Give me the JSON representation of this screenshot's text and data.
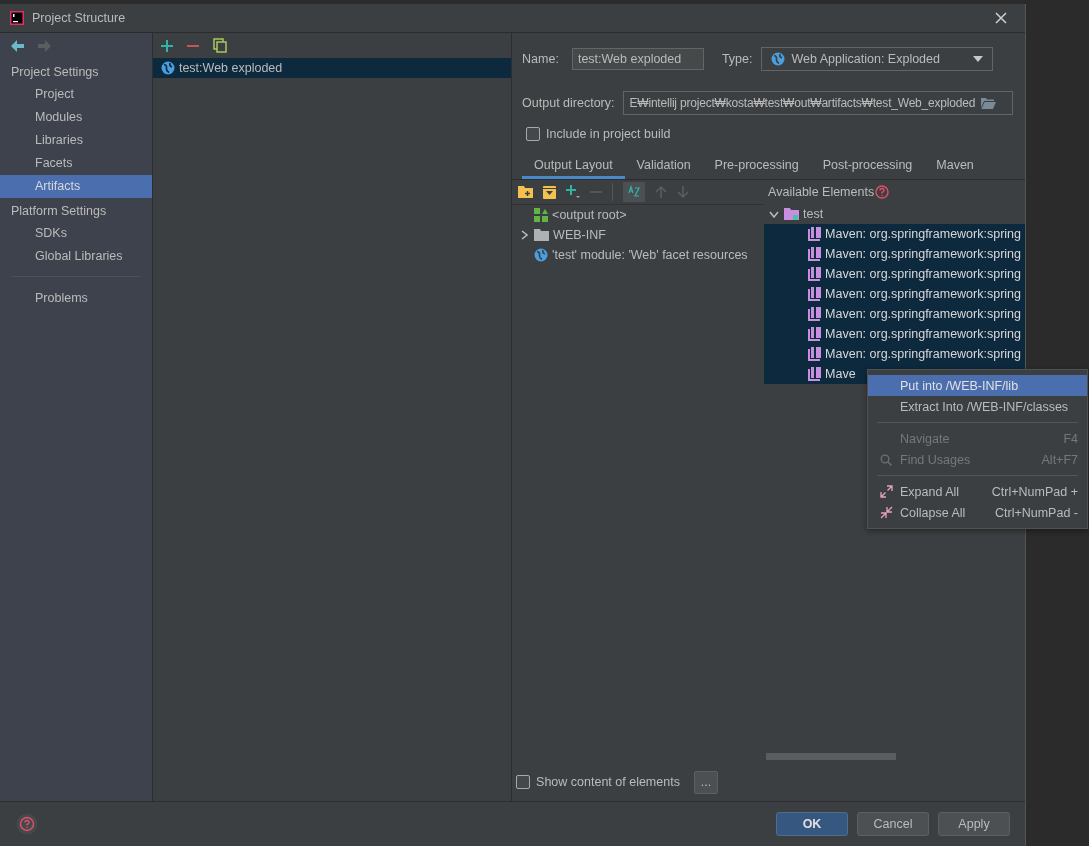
{
  "window": {
    "title": "Project Structure"
  },
  "sidebar": {
    "sections": [
      {
        "title": "Project Settings",
        "items": [
          {
            "label": "Project",
            "selected": false
          },
          {
            "label": "Modules",
            "selected": false
          },
          {
            "label": "Libraries",
            "selected": false
          },
          {
            "label": "Facets",
            "selected": false
          },
          {
            "label": "Artifacts",
            "selected": true
          }
        ]
      },
      {
        "title": "Platform Settings",
        "items": [
          {
            "label": "SDKs",
            "selected": false
          },
          {
            "label": "Global Libraries",
            "selected": false
          }
        ]
      }
    ],
    "footer_items": [
      {
        "label": "Problems",
        "selected": false
      }
    ]
  },
  "artifacts": [
    {
      "label": "test:Web exploded",
      "selected": true
    }
  ],
  "form": {
    "name_label": "Name:",
    "name": "test:Web exploded",
    "type_label": "Type:",
    "type": "Web Application: Exploded",
    "output_label": "Output directory:",
    "output": "E₩intellij project₩kosta₩test₩out₩artifacts₩test_Web_exploded",
    "include": {
      "label": "Include in project build",
      "checked": false
    }
  },
  "tabs": [
    {
      "label": "Output Layout",
      "selected": true
    },
    {
      "label": "Validation",
      "selected": false
    },
    {
      "label": "Pre-processing",
      "selected": false
    },
    {
      "label": "Post-processing",
      "selected": false
    },
    {
      "label": "Maven",
      "selected": false
    }
  ],
  "output_layout": [
    {
      "label": "<output root>",
      "kind": "root"
    },
    {
      "label": "WEB-INF",
      "kind": "folder",
      "expanded": false
    },
    {
      "label": "'test' module: 'Web' facet resources",
      "kind": "web"
    }
  ],
  "available": {
    "title": "Available Elements",
    "tree": [
      {
        "label": "test",
        "expanded": true,
        "selected": false,
        "children": [
          {
            "label": "Maven: org.springframework:spring",
            "selected": true
          },
          {
            "label": "Maven: org.springframework:spring",
            "selected": true
          },
          {
            "label": "Maven: org.springframework:spring",
            "selected": true
          },
          {
            "label": "Maven: org.springframework:spring",
            "selected": true
          },
          {
            "label": "Maven: org.springframework:spring",
            "selected": true
          },
          {
            "label": "Maven: org.springframework:spring",
            "selected": true
          },
          {
            "label": "Maven: org.springframework:spring",
            "selected": true
          },
          {
            "label": "Mave",
            "selected": true
          }
        ]
      }
    ]
  },
  "show_content": {
    "label": "Show content of elements",
    "checked": false,
    "button": "..."
  },
  "context_menu": [
    {
      "kind": "item",
      "label": "Put into /WEB-INF/lib",
      "selected": true,
      "disabled": false
    },
    {
      "kind": "item",
      "label": "Extract Into /WEB-INF/classes",
      "selected": false,
      "disabled": false
    },
    {
      "kind": "separator"
    },
    {
      "kind": "item",
      "label": "Navigate",
      "shortcut": "F4",
      "selected": false,
      "disabled": true
    },
    {
      "kind": "item",
      "label": "Find Usages",
      "shortcut": "Alt+F7",
      "selected": false,
      "disabled": true
    },
    {
      "kind": "separator"
    },
    {
      "kind": "item",
      "label": "Expand All",
      "shortcut": "Ctrl+NumPad +",
      "selected": false,
      "disabled": false
    },
    {
      "kind": "item",
      "label": "Collapse All",
      "shortcut": "Ctrl+NumPad -",
      "selected": false,
      "disabled": false
    }
  ],
  "buttons": [
    {
      "label": "OK",
      "kind": "primary"
    },
    {
      "label": "Cancel",
      "kind": "normal"
    },
    {
      "label": "Apply",
      "kind": "normal"
    }
  ]
}
